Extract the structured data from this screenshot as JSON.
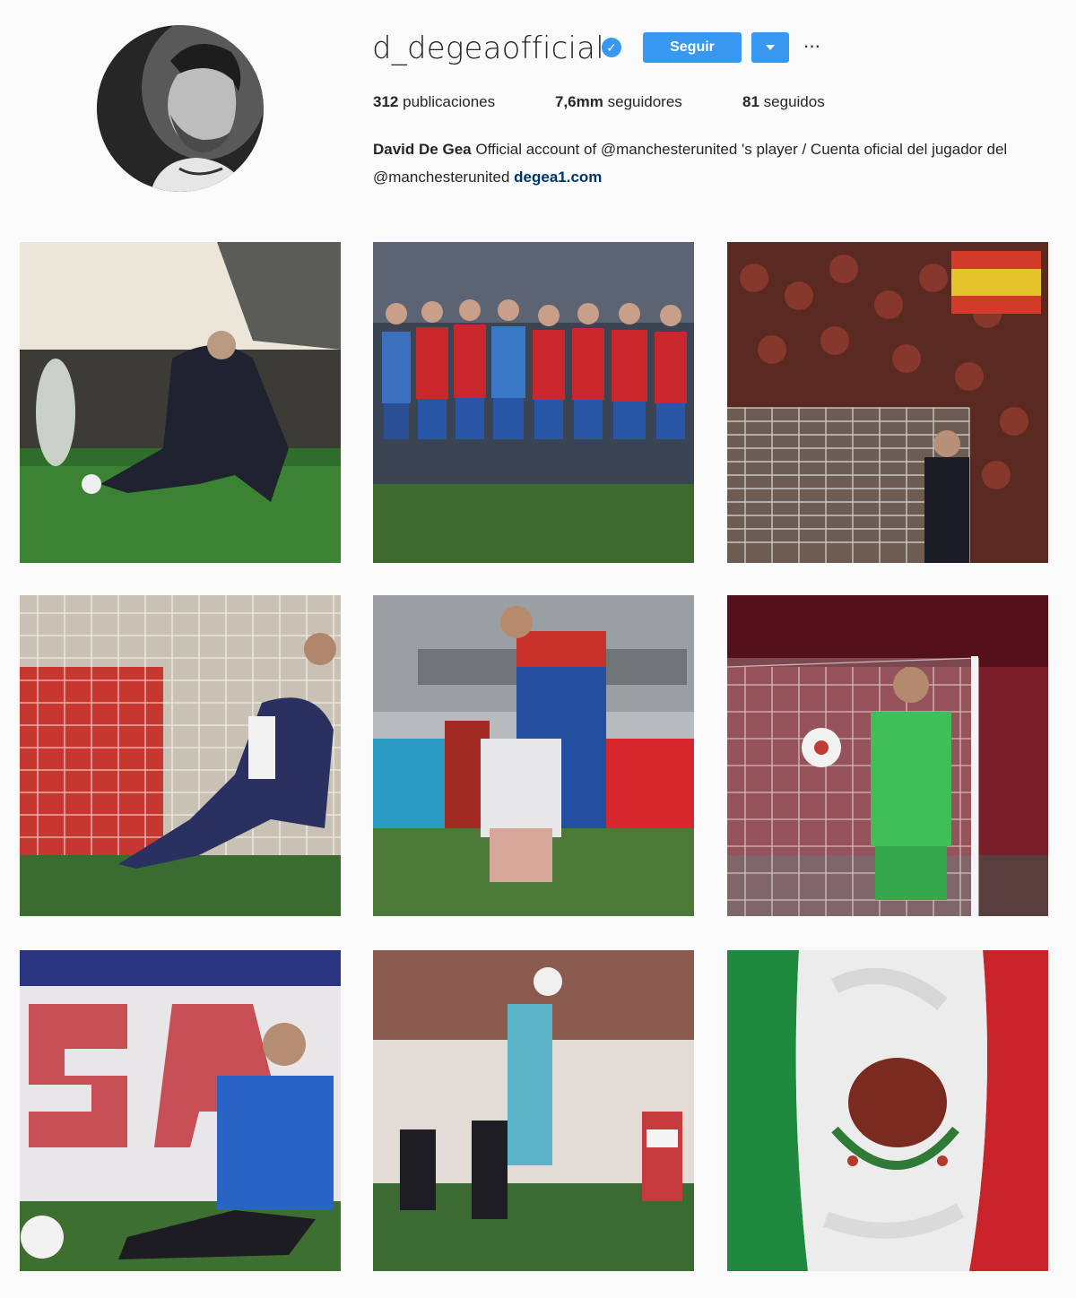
{
  "profile": {
    "username": "d_degeaofficial",
    "verified_icon": "verified-badge-icon",
    "follow_label": "Seguir",
    "more_label": "···"
  },
  "stats": {
    "posts_count": "312",
    "posts_label": "publicaciones",
    "followers_count": "7,6mm",
    "followers_label": "seguidores",
    "following_count": "81",
    "following_label": "seguidos"
  },
  "bio": {
    "name": "David De Gea",
    "text": "Official account of @manchesterunited 's player / Cuenta oficial del jugador del @manchesterunited",
    "link": "degea1.com"
  },
  "colors": {
    "accent": "#3897f0",
    "background": "#fafafa",
    "text": "#262626",
    "link": "#003569"
  },
  "posts": [
    {
      "icon": "goalkeeper-diving-photo"
    },
    {
      "icon": "spain-team-group-photo"
    },
    {
      "icon": "goalkeeper-fans-photo"
    },
    {
      "icon": "goalkeeper-net-save-photo"
    },
    {
      "icon": "player-hugging-child-photo"
    },
    {
      "icon": "goalkeeper-green-kit-photo"
    },
    {
      "icon": "goalkeeper-blue-kit-photo"
    },
    {
      "icon": "goalkeeper-catching-ball-photo"
    },
    {
      "icon": "mexico-flag-photo"
    }
  ]
}
